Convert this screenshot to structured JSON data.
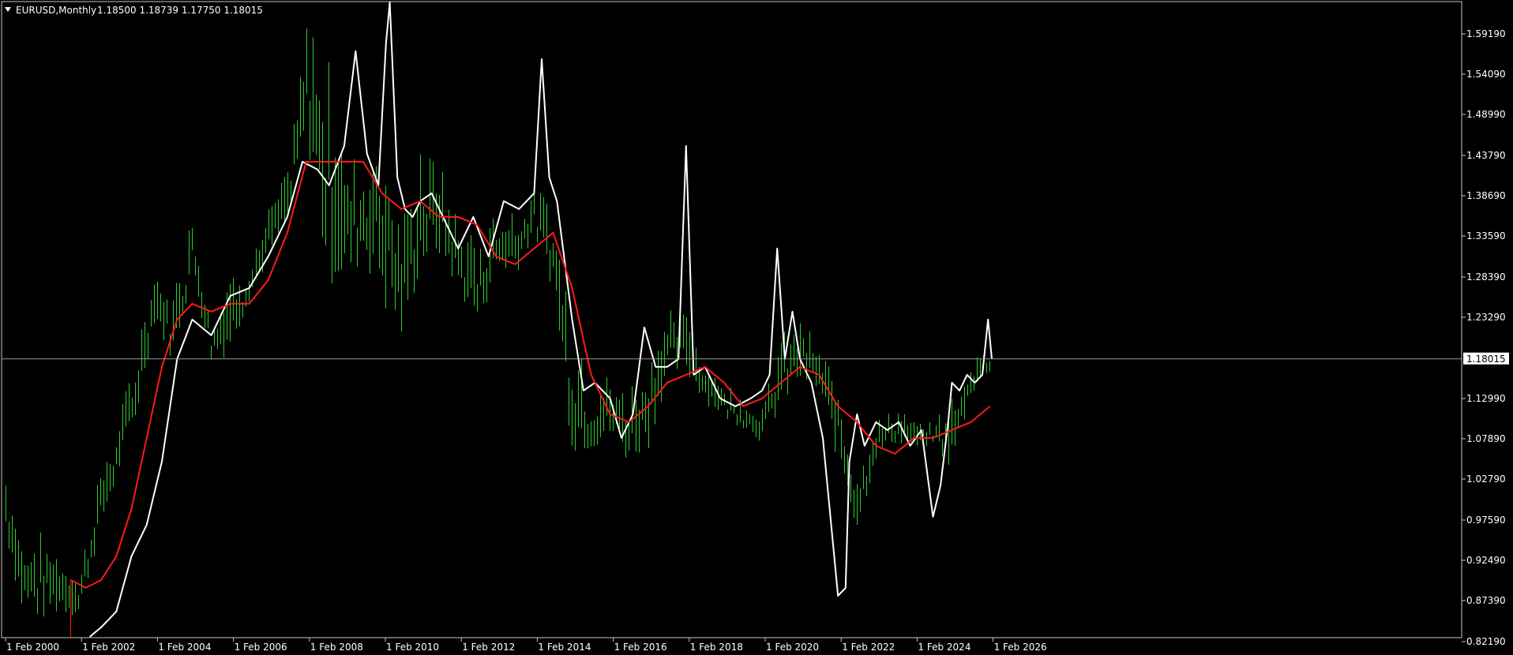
{
  "header": {
    "symbol": "EURUSD,Monthly",
    "ohlc": "1.18500 1.18739 1.17750 1.18015"
  },
  "colors": {
    "background": "#000000",
    "bars": "#2ecc2e",
    "price_line": "#ffffff",
    "ma_line": "#ff1a1a",
    "frame": "#c8c8c8",
    "grid_line": "#9a9a9a"
  },
  "chart_data": {
    "type": "line",
    "x_tick_labels": [
      "1 Feb 2000",
      "1 Feb 2002",
      "1 Feb 2004",
      "1 Feb 2006",
      "1 Feb 2008",
      "1 Feb 2010",
      "1 Feb 2012",
      "1 Feb 2014",
      "1 Feb 2016",
      "1 Feb 2018",
      "1 Feb 2020",
      "1 Feb 2022",
      "1 Feb 2024",
      "1 Feb 2026"
    ],
    "y_tick_labels": [
      "1.59190",
      "1.54090",
      "1.48990",
      "1.43790",
      "1.38690",
      "1.33590",
      "1.28390",
      "1.23290",
      "1.18015",
      "1.12990",
      "1.07890",
      "1.02790",
      "0.97590",
      "0.92490",
      "0.87390",
      "0.82190"
    ],
    "current_price": 1.18015,
    "current_price_label": "1.18015",
    "ylim": [
      0.7993,
      1.6322
    ],
    "xlim": [
      2000.0,
      2038.6
    ],
    "grid": false,
    "series": [
      {
        "kind": "ohlc_bars",
        "x": [
          2000.08,
          2000.5,
          2001.0,
          2001.5,
          2002.0,
          2002.5,
          2003.0,
          2003.5,
          2004.0,
          2004.5,
          2005.0,
          2005.5,
          2006.0,
          2006.5,
          2007.0,
          2007.5,
          2008.0,
          2008.5,
          2009.0,
          2009.5,
          2010.0,
          2010.5,
          2011.0,
          2011.5,
          2012.0,
          2012.5,
          2013.0,
          2013.5,
          2014.0,
          2014.5,
          2015.0,
          2015.5,
          2016.0,
          2016.5,
          2017.0,
          2017.5,
          2018.0,
          2018.5,
          2019.0,
          2019.5,
          2020.0,
          2020.5,
          2021.0,
          2021.5,
          2022.0,
          2022.5,
          2023.0,
          2023.5,
          2024.0,
          2024.5,
          2025.0,
          2025.5,
          2026.0
        ],
        "high": [
          1.04,
          0.96,
          0.96,
          0.94,
          0.9,
          1.03,
          1.09,
          1.19,
          1.29,
          1.26,
          1.37,
          1.24,
          1.29,
          1.3,
          1.37,
          1.42,
          1.6,
          1.59,
          1.45,
          1.43,
          1.51,
          1.35,
          1.44,
          1.43,
          1.35,
          1.33,
          1.37,
          1.38,
          1.4,
          1.37,
          1.23,
          1.14,
          1.16,
          1.14,
          1.2,
          1.24,
          1.25,
          1.18,
          1.15,
          1.13,
          1.12,
          1.21,
          1.24,
          1.19,
          1.15,
          1.06,
          1.1,
          1.12,
          1.1,
          1.1,
          1.13,
          1.18,
          1.2
        ],
        "low": [
          0.95,
          0.85,
          0.84,
          0.85,
          0.85,
          0.94,
          1.02,
          1.09,
          1.22,
          1.17,
          1.28,
          1.17,
          1.18,
          1.25,
          1.3,
          1.34,
          1.45,
          1.26,
          1.25,
          1.3,
          1.22,
          1.19,
          1.28,
          1.3,
          1.26,
          1.21,
          1.28,
          1.28,
          1.33,
          1.26,
          1.05,
          1.06,
          1.07,
          1.04,
          1.06,
          1.15,
          1.15,
          1.12,
          1.1,
          1.09,
          1.07,
          1.11,
          1.14,
          1.13,
          1.04,
          0.95,
          1.05,
          1.07,
          1.06,
          1.07,
          1.03,
          1.13,
          1.16
        ]
      },
      {
        "kind": "close_line",
        "x": [
          2002.3,
          2002.6,
          2003.0,
          2003.4,
          2003.8,
          2004.2,
          2004.6,
          2005.0,
          2005.5,
          2006.0,
          2006.5,
          2007.0,
          2007.5,
          2007.9,
          2008.3,
          2008.6,
          2009.0,
          2009.3,
          2009.6,
          2009.9,
          2010.1,
          2010.2,
          2010.4,
          2010.6,
          2010.8,
          2011.0,
          2011.3,
          2011.6,
          2012.0,
          2012.4,
          2012.8,
          2013.2,
          2013.6,
          2014.0,
          2014.2,
          2014.4,
          2014.6,
          2015.0,
          2015.3,
          2015.6,
          2016.0,
          2016.3,
          2016.6,
          2016.9,
          2017.2,
          2017.5,
          2017.8,
          2018.0,
          2018.2,
          2018.5,
          2018.9,
          2019.3,
          2019.7,
          2020.0,
          2020.2,
          2020.4,
          2020.6,
          2020.8,
          2021.0,
          2021.3,
          2021.6,
          2022.0,
          2022.2,
          2022.3,
          2022.5,
          2022.7,
          2023.0,
          2023.3,
          2023.6,
          2023.9,
          2024.2,
          2024.5,
          2024.7,
          2024.9,
          2025.0,
          2025.2,
          2025.4,
          2025.6,
          2025.8,
          2025.95,
          2026.05
        ],
        "y": [
          0.82,
          0.84,
          0.86,
          0.93,
          0.97,
          1.05,
          1.18,
          1.23,
          1.21,
          1.26,
          1.27,
          1.31,
          1.36,
          1.43,
          1.42,
          1.4,
          1.45,
          1.57,
          1.44,
          1.4,
          1.58,
          1.67,
          1.41,
          1.37,
          1.36,
          1.38,
          1.39,
          1.36,
          1.32,
          1.36,
          1.31,
          1.38,
          1.37,
          1.39,
          1.56,
          1.41,
          1.38,
          1.23,
          1.14,
          1.15,
          1.13,
          1.08,
          1.11,
          1.22,
          1.17,
          1.17,
          1.18,
          1.45,
          1.16,
          1.17,
          1.13,
          1.12,
          1.13,
          1.14,
          1.16,
          1.32,
          1.18,
          1.24,
          1.18,
          1.15,
          1.08,
          0.88,
          0.89,
          1.05,
          1.11,
          1.07,
          1.1,
          1.09,
          1.1,
          1.07,
          1.09,
          0.98,
          1.02,
          1.1,
          1.15,
          1.14,
          1.16,
          1.15,
          1.16,
          1.23,
          1.18
        ]
      },
      {
        "kind": "moving_average",
        "x": [
          2001.8,
          2002.2,
          2002.6,
          2003.0,
          2003.4,
          2003.8,
          2004.2,
          2004.6,
          2005.0,
          2005.5,
          2006.0,
          2006.5,
          2007.0,
          2007.5,
          2008.0,
          2008.5,
          2009.0,
          2009.5,
          2010.0,
          2010.5,
          2011.0,
          2011.5,
          2012.0,
          2012.5,
          2013.0,
          2013.5,
          2014.0,
          2014.5,
          2015.0,
          2015.5,
          2016.0,
          2016.5,
          2017.0,
          2017.5,
          2018.0,
          2018.5,
          2019.0,
          2019.5,
          2020.0,
          2020.5,
          2021.0,
          2021.5,
          2022.0,
          2022.5,
          2023.0,
          2023.5,
          2024.0,
          2024.5,
          2025.0,
          2025.5,
          2026.0
        ],
        "y": [
          0.9,
          0.89,
          0.9,
          0.93,
          0.99,
          1.08,
          1.17,
          1.23,
          1.25,
          1.24,
          1.25,
          1.25,
          1.28,
          1.34,
          1.43,
          1.43,
          1.43,
          1.43,
          1.39,
          1.37,
          1.38,
          1.36,
          1.36,
          1.35,
          1.31,
          1.3,
          1.32,
          1.34,
          1.27,
          1.16,
          1.11,
          1.1,
          1.12,
          1.15,
          1.16,
          1.17,
          1.15,
          1.12,
          1.13,
          1.15,
          1.17,
          1.16,
          1.12,
          1.1,
          1.07,
          1.06,
          1.08,
          1.08,
          1.09,
          1.1,
          1.12
        ]
      }
    ]
  }
}
